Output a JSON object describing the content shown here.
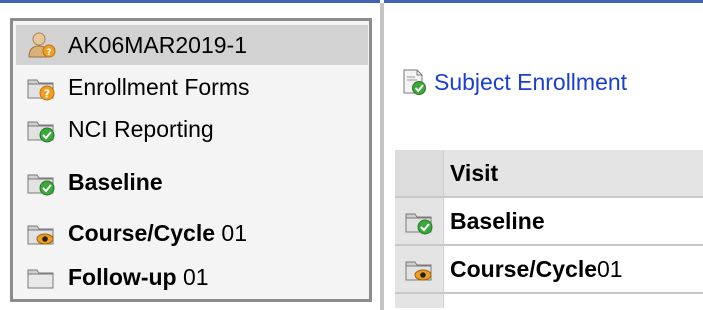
{
  "tree": {
    "items": [
      {
        "bold": "",
        "label": "AK06MAR2019-1",
        "icon": "subject-person-icon",
        "selected": true
      },
      {
        "bold": "",
        "label": "Enrollment Forms",
        "icon": "folder-question-icon"
      },
      {
        "bold": "",
        "label": "NCI Reporting",
        "icon": "folder-check-icon"
      },
      {
        "bold": "Baseline",
        "label": "",
        "icon": "folder-check-icon"
      },
      {
        "bold": "Course/Cycle",
        "label": " 01",
        "icon": "folder-eye-icon"
      },
      {
        "bold": "Follow-up",
        "label": " 01",
        "icon": "folder-empty-icon"
      }
    ]
  },
  "main": {
    "title": "Subject Enrollment",
    "title_icon": "document-check-icon",
    "table": {
      "header": "Visit",
      "rows": [
        {
          "bold": "Baseline",
          "label": "",
          "icon": "folder-check-icon"
        },
        {
          "bold": "Course/Cycle",
          "label": " 01",
          "icon": "folder-eye-icon"
        }
      ]
    }
  },
  "colors": {
    "accent_blue": "#3f64b3",
    "link_blue": "#1a3fd0",
    "check_green": "#3aa83a",
    "question_orange": "#f0a020",
    "eye_orange": "#f0a020"
  }
}
